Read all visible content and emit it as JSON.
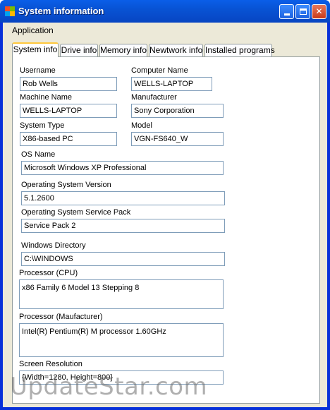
{
  "window": {
    "title": "System information"
  },
  "menu": {
    "items": [
      "Application"
    ]
  },
  "tabs": [
    "System info",
    "Drive info",
    "Memory info",
    "Newtwork info",
    "Installed programs"
  ],
  "fields": {
    "username": {
      "label": "Username",
      "value": "Rob Wells"
    },
    "computer_name": {
      "label": "Computer Name",
      "value": "WELLS-LAPTOP"
    },
    "machine_name": {
      "label": "Machine Name",
      "value": "WELLS-LAPTOP"
    },
    "manufacturer": {
      "label": "Manufacturer",
      "value": "Sony Corporation"
    },
    "system_type": {
      "label": "System Type",
      "value": "X86-based PC"
    },
    "model": {
      "label": "Model",
      "value": "VGN-FS640_W"
    },
    "os_name": {
      "label": "OS Name",
      "value": "Microsoft Windows XP Professional"
    },
    "os_version": {
      "label": "Operating System Version",
      "value": "5.1.2600"
    },
    "os_service_pack": {
      "label": "Operating System Service Pack",
      "value": "Service Pack 2"
    },
    "windows_directory": {
      "label": "Windows Directory",
      "value": "C:\\WINDOWS"
    },
    "processor_cpu": {
      "label": "Processor  (CPU)",
      "value": "x86 Family 6 Model 13 Stepping 8"
    },
    "processor_manufacturer": {
      "label": "Processor  (Maufacturer)",
      "value": "Intel(R) Pentium(R) M processor 1.60GHz"
    },
    "screen_resolution": {
      "label": "Screen Resolution",
      "value": "{Width=1280, Height=800}"
    }
  },
  "watermark": "UpdateStar.com"
}
